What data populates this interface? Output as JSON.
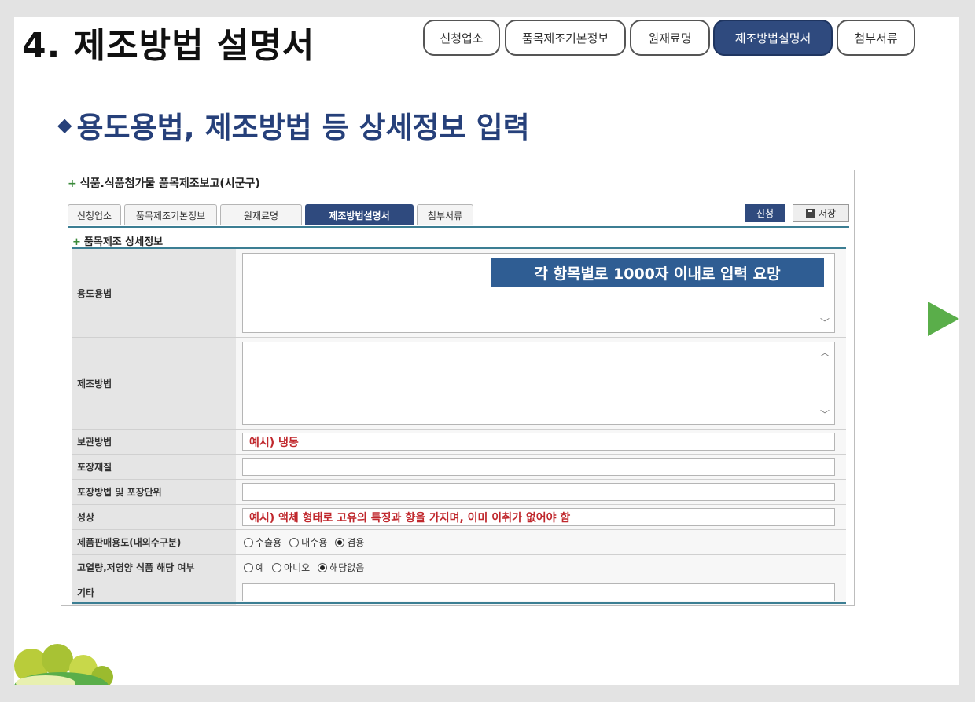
{
  "slide": {
    "title": "4. 제조방법 설명서",
    "steps": [
      "신청업소",
      "품목제조기본정보",
      "원재료명",
      "제조방법설명서",
      "첨부서류"
    ],
    "active_step": 3,
    "subtitle": "용도용법, 제조방법 등 상세정보 입력",
    "subtitle_marker": "◆"
  },
  "form": {
    "title": "식품.식품첨가물 품목제조보고(시군구)",
    "tabs": [
      "신청업소",
      "품목제조기본정보",
      "원재료명",
      "제조방법설명서",
      "첨부서류"
    ],
    "active_tab": 3,
    "apply_label": "신청",
    "save_label": "저장",
    "section_title": "품목제조 상세정보",
    "callout": "각 항목별로 1000자 이내로 입력 요망",
    "fields": {
      "usage_label": "용도용법",
      "method_label": "제조방법",
      "storage_label": "보관방법",
      "storage_value": "예시) 냉동",
      "packaging_material_label": "포장재질",
      "packaging_method_label": "포장방법 및 포장단위",
      "properties_label": "성상",
      "properties_value": "예시) 액체 형태로 고유의 특징과 향을 가지며, 이미 이취가 없어야 함",
      "sales_use_label": "제품판매용도(내외수구분)",
      "sales_use_options": [
        "수출용",
        "내수용",
        "겸용"
      ],
      "sales_use_selected": 2,
      "high_calorie_label": "고열량,저영양 식품 해당 여부",
      "high_calorie_options": [
        "예",
        "아니오",
        "해당없음"
      ],
      "high_calorie_selected": 2,
      "etc_label": "기타"
    }
  },
  "colors": {
    "navy": "#2f4a7e",
    "callout_blue": "#2f5d93",
    "example_red": "#c0282d",
    "accent_teal": "#3c7e93",
    "arrow_green": "#5aae4a"
  }
}
